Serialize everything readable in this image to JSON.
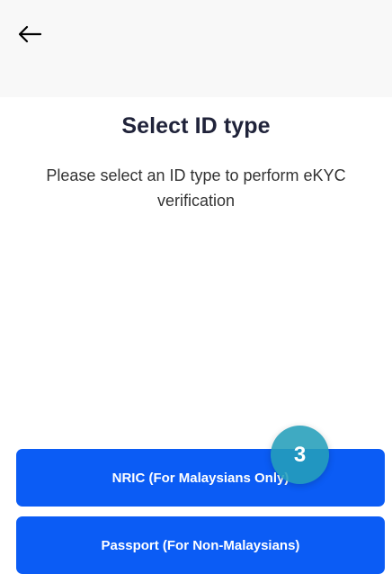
{
  "header": {
    "back_icon": "arrow-left-icon"
  },
  "main": {
    "title": "Select ID type",
    "subtitle": "Please select an ID type to perform eKYC verification"
  },
  "options": [
    {
      "label": "NRIC (For Malaysians Only)"
    },
    {
      "label": "Passport (For Non-Malaysians)"
    }
  ],
  "overlay": {
    "step_number": "3"
  },
  "colors": {
    "primary_button": "#0b5cf5",
    "step_badge": "#249eb9",
    "title_text": "#20233a"
  }
}
